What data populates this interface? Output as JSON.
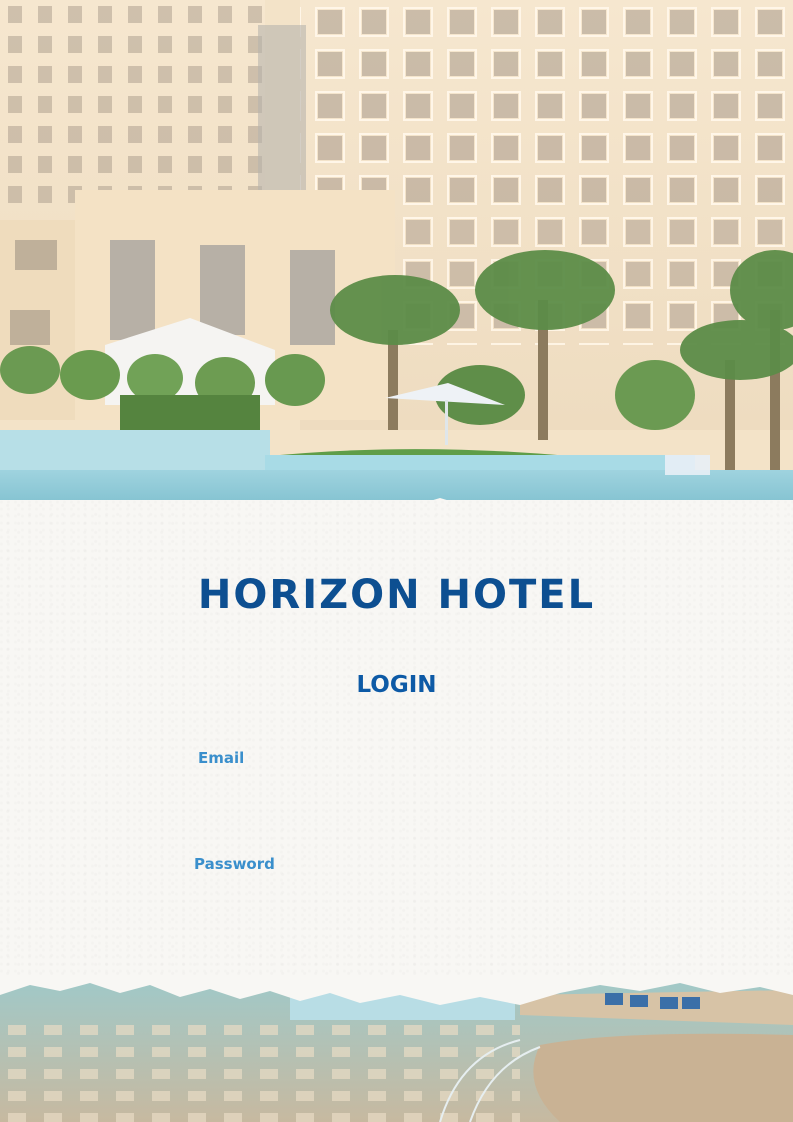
{
  "hotel": {
    "name": "HORIZON HOTEL"
  },
  "login": {
    "title": "LOGIN"
  },
  "form": {
    "email_label": "Email",
    "email_value": "",
    "password_label": "Password",
    "password_value": ""
  },
  "colors": {
    "brand": "#0d4f91",
    "title": "#0d5aa6",
    "label": "#3a8fcc",
    "paper": "#f8f7f4"
  }
}
